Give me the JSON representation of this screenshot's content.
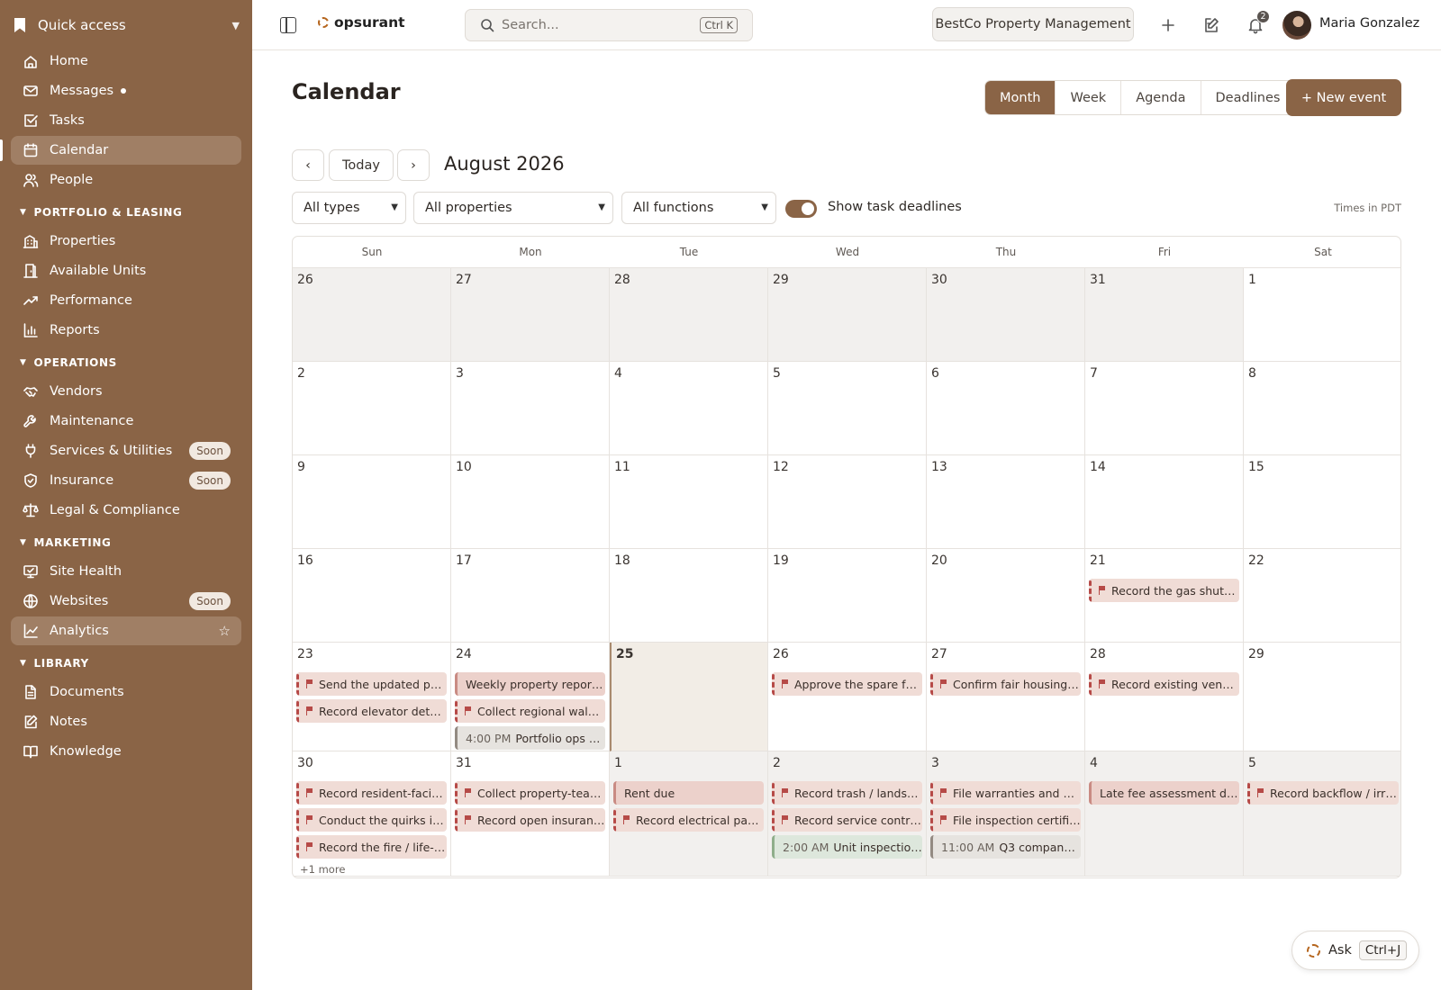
{
  "sidebar": {
    "quick_access": "Quick access",
    "top": [
      {
        "label": "Home",
        "icon": "home-icon"
      },
      {
        "label": "Messages",
        "icon": "mail-icon",
        "dot": true
      },
      {
        "label": "Tasks",
        "icon": "check-square-icon"
      },
      {
        "label": "Calendar",
        "icon": "calendar-icon",
        "active": true
      },
      {
        "label": "People",
        "icon": "people-icon"
      }
    ],
    "sections": [
      {
        "title": "PORTFOLIO & LEASING",
        "items": [
          {
            "label": "Properties",
            "icon": "building-icon"
          },
          {
            "label": "Available Units",
            "icon": "door-icon"
          },
          {
            "label": "Performance",
            "icon": "trend-icon"
          },
          {
            "label": "Reports",
            "icon": "bar-chart-icon"
          }
        ]
      },
      {
        "title": "OPERATIONS",
        "items": [
          {
            "label": "Vendors",
            "icon": "handshake-icon"
          },
          {
            "label": "Maintenance",
            "icon": "wrench-icon"
          },
          {
            "label": "Services & Utilities",
            "icon": "plug-icon",
            "badge": "Soon"
          },
          {
            "label": "Insurance",
            "icon": "shield-icon",
            "badge": "Soon"
          },
          {
            "label": "Legal & Compliance",
            "icon": "scale-icon"
          }
        ]
      },
      {
        "title": "MARKETING",
        "items": [
          {
            "label": "Site Health",
            "icon": "monitor-check-icon"
          },
          {
            "label": "Websites",
            "icon": "globe-icon",
            "badge": "Soon"
          },
          {
            "label": "Analytics",
            "icon": "line-chart-icon",
            "star": true,
            "hover": true
          }
        ]
      },
      {
        "title": "LIBRARY",
        "items": [
          {
            "label": "Documents",
            "icon": "document-icon"
          },
          {
            "label": "Notes",
            "icon": "note-icon"
          },
          {
            "label": "Knowledge",
            "icon": "book-icon"
          }
        ]
      }
    ]
  },
  "topbar": {
    "app_name": "opsurant",
    "search_placeholder": "Search...",
    "search_shortcut": "Ctrl K",
    "company": "BestCo Property Management",
    "notification_count": "2",
    "user_name": "Maria Gonzalez"
  },
  "page": {
    "title": "Calendar",
    "views": [
      "Month",
      "Week",
      "Agenda",
      "Deadlines"
    ],
    "active_view": "Month",
    "new_event_label": "+ New event",
    "prev_label": "‹",
    "today_label": "Today",
    "next_label": "›",
    "month_title": "August 2026",
    "filters": {
      "types": "All types",
      "properties": "All properties",
      "functions": "All functions"
    },
    "toggle_label": "Show task deadlines",
    "timezone": "Times in PDT"
  },
  "calendar": {
    "weekdays": [
      "Sun",
      "Mon",
      "Tue",
      "Wed",
      "Thu",
      "Fri",
      "Sat"
    ],
    "weeks": [
      [
        {
          "day": "26",
          "out": true,
          "events": []
        },
        {
          "day": "27",
          "out": true,
          "events": []
        },
        {
          "day": "28",
          "out": true,
          "events": []
        },
        {
          "day": "29",
          "out": true,
          "events": []
        },
        {
          "day": "30",
          "out": true,
          "events": []
        },
        {
          "day": "31",
          "out": true,
          "events": []
        },
        {
          "day": "1",
          "events": []
        }
      ],
      [
        {
          "day": "2",
          "events": []
        },
        {
          "day": "3",
          "events": []
        },
        {
          "day": "4",
          "events": []
        },
        {
          "day": "5",
          "events": []
        },
        {
          "day": "6",
          "events": []
        },
        {
          "day": "7",
          "events": []
        },
        {
          "day": "8",
          "events": []
        }
      ],
      [
        {
          "day": "9",
          "events": []
        },
        {
          "day": "10",
          "events": []
        },
        {
          "day": "11",
          "events": []
        },
        {
          "day": "12",
          "events": []
        },
        {
          "day": "13",
          "events": []
        },
        {
          "day": "14",
          "events": []
        },
        {
          "day": "15",
          "events": []
        }
      ],
      [
        {
          "day": "16",
          "events": []
        },
        {
          "day": "17",
          "events": []
        },
        {
          "day": "18",
          "events": []
        },
        {
          "day": "19",
          "events": []
        },
        {
          "day": "20",
          "events": []
        },
        {
          "day": "21",
          "events": [
            {
              "kind": "deadline",
              "text": "Record the gas shut-o..."
            }
          ]
        },
        {
          "day": "22",
          "events": []
        }
      ],
      [
        {
          "day": "23",
          "events": [
            {
              "kind": "deadline",
              "text": "Send the updated park..."
            },
            {
              "kind": "deadline",
              "text": "Record elevator details..."
            }
          ]
        },
        {
          "day": "24",
          "events": [
            {
              "kind": "solid",
              "text": "Weekly property reports ..."
            },
            {
              "kind": "deadline",
              "text": "Collect regional walk-t..."
            },
            {
              "kind": "timed",
              "time": "4:00 PM",
              "text": "Portfolio ops sy..."
            }
          ]
        },
        {
          "day": "25",
          "today": true,
          "events": []
        },
        {
          "day": "26",
          "events": [
            {
              "kind": "deadline",
              "text": "Approve the spare fob ..."
            }
          ]
        },
        {
          "day": "27",
          "events": [
            {
              "kind": "deadline",
              "text": "Confirm fair housing tr..."
            }
          ]
        },
        {
          "day": "28",
          "events": [
            {
              "kind": "deadline",
              "text": "Record existing vendor..."
            }
          ]
        },
        {
          "day": "29",
          "events": []
        }
      ],
      [
        {
          "day": "30",
          "events": [
            {
              "kind": "deadline",
              "text": "Record resident-facin..."
            },
            {
              "kind": "deadline",
              "text": "Conduct the quirks int..."
            },
            {
              "kind": "deadline",
              "text": "Record the fire / life-sa..."
            }
          ],
          "more": "+1 more"
        },
        {
          "day": "31",
          "events": [
            {
              "kind": "deadline",
              "text": "Collect property-team..."
            },
            {
              "kind": "deadline",
              "text": "Record open insurance..."
            }
          ]
        },
        {
          "day": "1",
          "out": true,
          "events": [
            {
              "kind": "solid",
              "text": "Rent due"
            },
            {
              "kind": "deadline",
              "text": "Record electrical panel..."
            }
          ]
        },
        {
          "day": "2",
          "out": true,
          "events": [
            {
              "kind": "deadline",
              "text": "Record trash / landsca..."
            },
            {
              "kind": "deadline",
              "text": "Record service contra..."
            },
            {
              "kind": "timed-green",
              "time": "2:00 AM",
              "text": "Unit inspection..."
            }
          ]
        },
        {
          "day": "3",
          "out": true,
          "events": [
            {
              "kind": "deadline",
              "text": "File warranties and ma..."
            },
            {
              "kind": "deadline",
              "text": "File inspection certific..."
            },
            {
              "kind": "timed",
              "time": "11:00 AM",
              "text": "Q3 company all..."
            }
          ]
        },
        {
          "day": "4",
          "out": true,
          "events": [
            {
              "kind": "solid",
              "text": "Late fee assessment day"
            }
          ]
        },
        {
          "day": "5",
          "out": true,
          "events": [
            {
              "kind": "deadline",
              "text": "Record backflow / irrig..."
            }
          ]
        }
      ]
    ]
  },
  "assistant": {
    "label": "Ask",
    "shortcut": "Ctrl+J"
  }
}
